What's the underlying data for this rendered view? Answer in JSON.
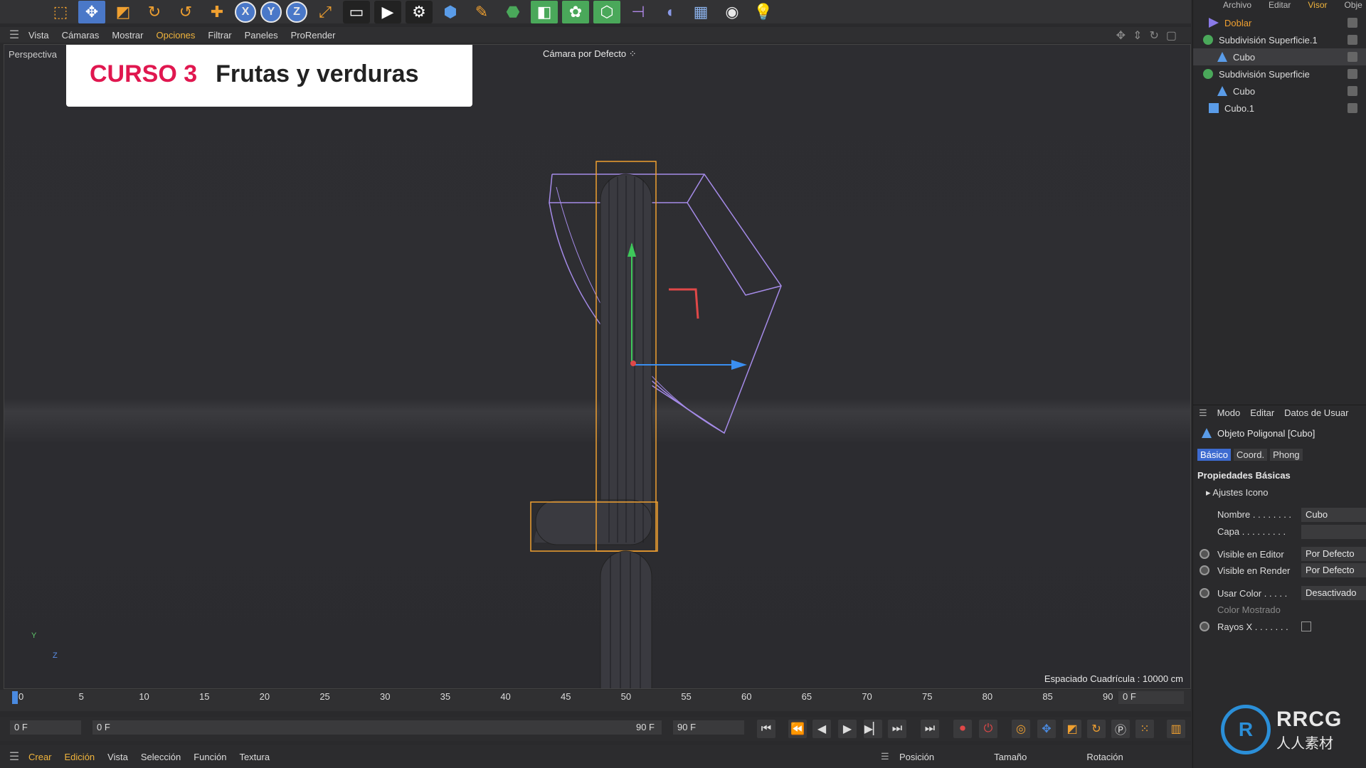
{
  "toolbar": {
    "icons": [
      "select-icon",
      "move-icon",
      "scale-icon",
      "rotate-icon",
      "recent-tools-icon",
      "axis-add-icon",
      "x-axis-icon",
      "y-axis-icon",
      "z-axis-icon",
      "coord-system-icon",
      "render-region-icon",
      "render-view-icon",
      "render-settings-icon",
      "cube-icon",
      "pen-icon",
      "subdivision-icon",
      "extrude-icon",
      "cloner-icon",
      "voronoi-icon",
      "bend-icon",
      "deformer-icon",
      "floor-icon",
      "camera-icon",
      "light-icon"
    ]
  },
  "viewport_menu": {
    "items": [
      "Vista",
      "Cámaras",
      "Mostrar",
      "Opciones",
      "Filtrar",
      "Paneles",
      "ProRender"
    ],
    "active_index": 3
  },
  "viewport": {
    "label": "Perspectiva",
    "camera": "Cámara por Defecto",
    "grid_spacing": "Espaciado Cuadrícula : 10000 cm",
    "axis_y": "Y",
    "axis_z": "Z"
  },
  "title_card": {
    "course": "CURSO 3",
    "topic": "Frutas y verduras"
  },
  "object_manager": {
    "menu": [
      "Archivo",
      "Editar",
      "Visor",
      "Obje"
    ],
    "active_index": 2,
    "objects": [
      {
        "label": "Doblar",
        "level": 0,
        "type": "bend"
      },
      {
        "label": "Subdivisión Superficie.1",
        "level": 0,
        "type": "subdivision"
      },
      {
        "label": "Cubo",
        "level": 1,
        "type": "polygon"
      },
      {
        "label": "Subdivisión Superficie",
        "level": 0,
        "type": "subdivision"
      },
      {
        "label": "Cubo",
        "level": 1,
        "type": "polygon"
      },
      {
        "label": "Cubo.1",
        "level": 0,
        "type": "cube"
      }
    ]
  },
  "attributes": {
    "menu": [
      "Modo",
      "Editar",
      "Datos de Usuar"
    ],
    "title": "Objeto Poligonal [Cubo]",
    "tabs": [
      "Básico",
      "Coord.",
      "Phong"
    ],
    "active_tab": 0,
    "section": "Propiedades Básicas",
    "subsection": "Ajustes Icono",
    "props": {
      "nombre_label": "Nombre . . . . . . . .",
      "nombre_value": "Cubo",
      "capa_label": "Capa . . . . . . . . .",
      "visible_editor_label": "Visible en Editor",
      "visible_editor_value": "Por Defecto",
      "visible_render_label": "Visible en Render",
      "visible_render_value": "Por Defecto",
      "usar_color_label": "Usar Color . . . . .",
      "usar_color_value": "Desactivado",
      "color_mostrado_label": "Color Mostrado",
      "rayos_x_label": "Rayos X . . . . . . ."
    }
  },
  "timeline": {
    "ticks": [
      "0",
      "5",
      "10",
      "15",
      "20",
      "25",
      "30",
      "35",
      "40",
      "45",
      "50",
      "55",
      "60",
      "65",
      "70",
      "75",
      "80",
      "85",
      "90"
    ],
    "current_frame": "0 F"
  },
  "transport": {
    "start": "0 F",
    "range_start": "0 F",
    "range_end": "90 F",
    "end": "90 F"
  },
  "bottom_menu": {
    "items": [
      "Crear",
      "Edición",
      "Vista",
      "Selección",
      "Función",
      "Textura"
    ],
    "coords": [
      "Posición",
      "Tamaño",
      "Rotación"
    ]
  },
  "watermark": {
    "big": "RRCG",
    "small": "人人素材"
  },
  "colors": {
    "accent": "#f0b43c",
    "brand_red": "#e0174f",
    "select_blue": "#3d6bd0",
    "object_orange": "#f0a030"
  }
}
